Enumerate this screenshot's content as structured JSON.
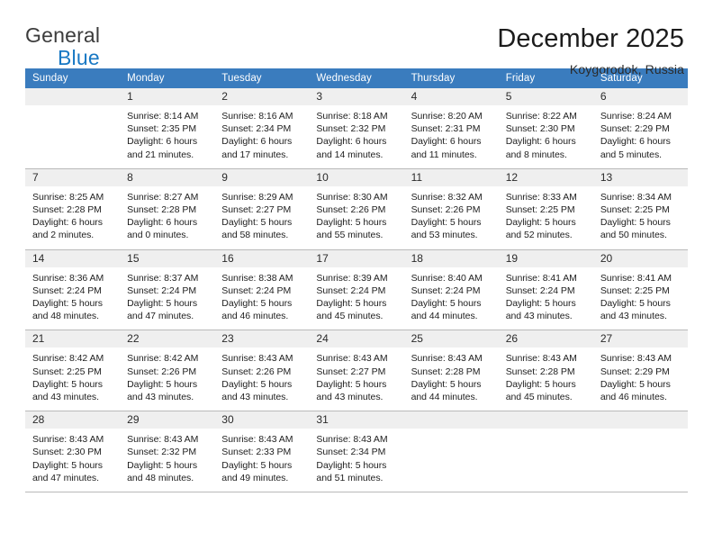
{
  "brand": {
    "line1": "General",
    "line2": "Blue",
    "triangle_color": "#1364a6",
    "blue_text_color": "#1878c4"
  },
  "header": {
    "month_title": "December 2025",
    "location": "Koygorodok, Russia"
  },
  "calendar": {
    "header_bg": "#3a7cbe",
    "daynum_bg": "#efefef",
    "weekday_headers": [
      "Sunday",
      "Monday",
      "Tuesday",
      "Wednesday",
      "Thursday",
      "Friday",
      "Saturday"
    ],
    "weeks": [
      [
        {
          "day": "",
          "sunrise": "",
          "sunset": "",
          "daylight1": "",
          "daylight2": ""
        },
        {
          "day": "1",
          "sunrise": "Sunrise: 8:14 AM",
          "sunset": "Sunset: 2:35 PM",
          "daylight1": "Daylight: 6 hours",
          "daylight2": "and 21 minutes."
        },
        {
          "day": "2",
          "sunrise": "Sunrise: 8:16 AM",
          "sunset": "Sunset: 2:34 PM",
          "daylight1": "Daylight: 6 hours",
          "daylight2": "and 17 minutes."
        },
        {
          "day": "3",
          "sunrise": "Sunrise: 8:18 AM",
          "sunset": "Sunset: 2:32 PM",
          "daylight1": "Daylight: 6 hours",
          "daylight2": "and 14 minutes."
        },
        {
          "day": "4",
          "sunrise": "Sunrise: 8:20 AM",
          "sunset": "Sunset: 2:31 PM",
          "daylight1": "Daylight: 6 hours",
          "daylight2": "and 11 minutes."
        },
        {
          "day": "5",
          "sunrise": "Sunrise: 8:22 AM",
          "sunset": "Sunset: 2:30 PM",
          "daylight1": "Daylight: 6 hours",
          "daylight2": "and 8 minutes."
        },
        {
          "day": "6",
          "sunrise": "Sunrise: 8:24 AM",
          "sunset": "Sunset: 2:29 PM",
          "daylight1": "Daylight: 6 hours",
          "daylight2": "and 5 minutes."
        }
      ],
      [
        {
          "day": "7",
          "sunrise": "Sunrise: 8:25 AM",
          "sunset": "Sunset: 2:28 PM",
          "daylight1": "Daylight: 6 hours",
          "daylight2": "and 2 minutes."
        },
        {
          "day": "8",
          "sunrise": "Sunrise: 8:27 AM",
          "sunset": "Sunset: 2:28 PM",
          "daylight1": "Daylight: 6 hours",
          "daylight2": "and 0 minutes."
        },
        {
          "day": "9",
          "sunrise": "Sunrise: 8:29 AM",
          "sunset": "Sunset: 2:27 PM",
          "daylight1": "Daylight: 5 hours",
          "daylight2": "and 58 minutes."
        },
        {
          "day": "10",
          "sunrise": "Sunrise: 8:30 AM",
          "sunset": "Sunset: 2:26 PM",
          "daylight1": "Daylight: 5 hours",
          "daylight2": "and 55 minutes."
        },
        {
          "day": "11",
          "sunrise": "Sunrise: 8:32 AM",
          "sunset": "Sunset: 2:26 PM",
          "daylight1": "Daylight: 5 hours",
          "daylight2": "and 53 minutes."
        },
        {
          "day": "12",
          "sunrise": "Sunrise: 8:33 AM",
          "sunset": "Sunset: 2:25 PM",
          "daylight1": "Daylight: 5 hours",
          "daylight2": "and 52 minutes."
        },
        {
          "day": "13",
          "sunrise": "Sunrise: 8:34 AM",
          "sunset": "Sunset: 2:25 PM",
          "daylight1": "Daylight: 5 hours",
          "daylight2": "and 50 minutes."
        }
      ],
      [
        {
          "day": "14",
          "sunrise": "Sunrise: 8:36 AM",
          "sunset": "Sunset: 2:24 PM",
          "daylight1": "Daylight: 5 hours",
          "daylight2": "and 48 minutes."
        },
        {
          "day": "15",
          "sunrise": "Sunrise: 8:37 AM",
          "sunset": "Sunset: 2:24 PM",
          "daylight1": "Daylight: 5 hours",
          "daylight2": "and 47 minutes."
        },
        {
          "day": "16",
          "sunrise": "Sunrise: 8:38 AM",
          "sunset": "Sunset: 2:24 PM",
          "daylight1": "Daylight: 5 hours",
          "daylight2": "and 46 minutes."
        },
        {
          "day": "17",
          "sunrise": "Sunrise: 8:39 AM",
          "sunset": "Sunset: 2:24 PM",
          "daylight1": "Daylight: 5 hours",
          "daylight2": "and 45 minutes."
        },
        {
          "day": "18",
          "sunrise": "Sunrise: 8:40 AM",
          "sunset": "Sunset: 2:24 PM",
          "daylight1": "Daylight: 5 hours",
          "daylight2": "and 44 minutes."
        },
        {
          "day": "19",
          "sunrise": "Sunrise: 8:41 AM",
          "sunset": "Sunset: 2:24 PM",
          "daylight1": "Daylight: 5 hours",
          "daylight2": "and 43 minutes."
        },
        {
          "day": "20",
          "sunrise": "Sunrise: 8:41 AM",
          "sunset": "Sunset: 2:25 PM",
          "daylight1": "Daylight: 5 hours",
          "daylight2": "and 43 minutes."
        }
      ],
      [
        {
          "day": "21",
          "sunrise": "Sunrise: 8:42 AM",
          "sunset": "Sunset: 2:25 PM",
          "daylight1": "Daylight: 5 hours",
          "daylight2": "and 43 minutes."
        },
        {
          "day": "22",
          "sunrise": "Sunrise: 8:42 AM",
          "sunset": "Sunset: 2:26 PM",
          "daylight1": "Daylight: 5 hours",
          "daylight2": "and 43 minutes."
        },
        {
          "day": "23",
          "sunrise": "Sunrise: 8:43 AM",
          "sunset": "Sunset: 2:26 PM",
          "daylight1": "Daylight: 5 hours",
          "daylight2": "and 43 minutes."
        },
        {
          "day": "24",
          "sunrise": "Sunrise: 8:43 AM",
          "sunset": "Sunset: 2:27 PM",
          "daylight1": "Daylight: 5 hours",
          "daylight2": "and 43 minutes."
        },
        {
          "day": "25",
          "sunrise": "Sunrise: 8:43 AM",
          "sunset": "Sunset: 2:28 PM",
          "daylight1": "Daylight: 5 hours",
          "daylight2": "and 44 minutes."
        },
        {
          "day": "26",
          "sunrise": "Sunrise: 8:43 AM",
          "sunset": "Sunset: 2:28 PM",
          "daylight1": "Daylight: 5 hours",
          "daylight2": "and 45 minutes."
        },
        {
          "day": "27",
          "sunrise": "Sunrise: 8:43 AM",
          "sunset": "Sunset: 2:29 PM",
          "daylight1": "Daylight: 5 hours",
          "daylight2": "and 46 minutes."
        }
      ],
      [
        {
          "day": "28",
          "sunrise": "Sunrise: 8:43 AM",
          "sunset": "Sunset: 2:30 PM",
          "daylight1": "Daylight: 5 hours",
          "daylight2": "and 47 minutes."
        },
        {
          "day": "29",
          "sunrise": "Sunrise: 8:43 AM",
          "sunset": "Sunset: 2:32 PM",
          "daylight1": "Daylight: 5 hours",
          "daylight2": "and 48 minutes."
        },
        {
          "day": "30",
          "sunrise": "Sunrise: 8:43 AM",
          "sunset": "Sunset: 2:33 PM",
          "daylight1": "Daylight: 5 hours",
          "daylight2": "and 49 minutes."
        },
        {
          "day": "31",
          "sunrise": "Sunrise: 8:43 AM",
          "sunset": "Sunset: 2:34 PM",
          "daylight1": "Daylight: 5 hours",
          "daylight2": "and 51 minutes."
        },
        {
          "day": "",
          "sunrise": "",
          "sunset": "",
          "daylight1": "",
          "daylight2": ""
        },
        {
          "day": "",
          "sunrise": "",
          "sunset": "",
          "daylight1": "",
          "daylight2": ""
        },
        {
          "day": "",
          "sunrise": "",
          "sunset": "",
          "daylight1": "",
          "daylight2": ""
        }
      ]
    ]
  }
}
